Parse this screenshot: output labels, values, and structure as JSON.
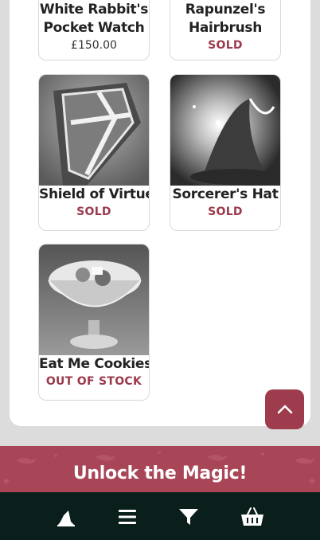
{
  "products": [
    {
      "name_line1": "White Rabbit's",
      "name_line2": "Pocket Watch",
      "price": "£150.00",
      "status": ""
    },
    {
      "name_line1": "Rapunzel's",
      "name_line2": "Hairbrush",
      "price": "",
      "status": "SOLD"
    },
    {
      "name": "Shield of Virtue",
      "status": "SOLD",
      "image": "shield-image"
    },
    {
      "name": "Sorcerer's Hat",
      "status": "SOLD",
      "image": "hat-image"
    },
    {
      "name": "Eat Me Cookies",
      "status": "OUT OF STOCK",
      "image": "cookies-bowl-image"
    }
  ],
  "banner": {
    "title": "Unlock the Magic!"
  },
  "bottom_nav": [
    {
      "icon": "wizard-hat-icon"
    },
    {
      "icon": "menu-icon"
    },
    {
      "icon": "filter-icon"
    },
    {
      "icon": "basket-icon"
    }
  ],
  "colors": {
    "accent": "#9e3b4c",
    "banner": "#a84557",
    "bottom_bar": "#0a1f1c"
  },
  "scroll_top_icon": "chevron-up-icon"
}
